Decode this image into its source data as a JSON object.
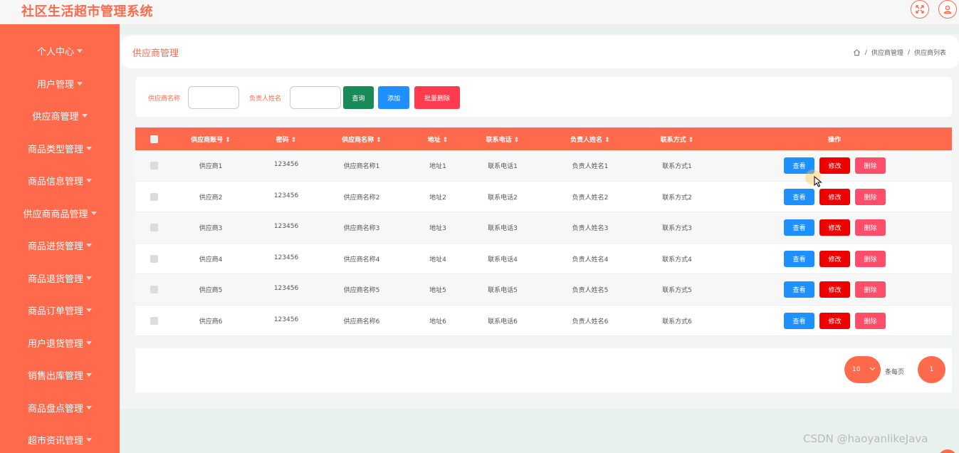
{
  "app": {
    "title": "社区生活超市管理系统"
  },
  "topbar": {
    "icons": [
      "fullscreen-icon",
      "user-icon"
    ]
  },
  "colors": {
    "accent": "#ff6a4d",
    "view": "#1e90ff",
    "edit": "#ee0000",
    "delete": "#ff4d6a",
    "query": "#1a8a5a"
  },
  "sidebar": {
    "items": [
      {
        "label": "个人中心"
      },
      {
        "label": "用户管理"
      },
      {
        "label": "供应商管理"
      },
      {
        "label": "商品类型管理"
      },
      {
        "label": "商品信息管理"
      },
      {
        "label": "供应商商品管理"
      },
      {
        "label": "商品进货管理"
      },
      {
        "label": "商品退货管理"
      },
      {
        "label": "商品订单管理"
      },
      {
        "label": "用户退货管理"
      },
      {
        "label": "销售出库管理"
      },
      {
        "label": "商品盘点管理"
      },
      {
        "label": "超市资讯管理"
      }
    ]
  },
  "header": {
    "page_title": "供应商管理",
    "breadcrumb": [
      "供应商管理",
      "供应商列表"
    ],
    "sep": "/"
  },
  "search": {
    "supplier_name_label": "供应商名称",
    "owner_name_label": "负责人姓名",
    "query_label": "查询",
    "add_label": "添加",
    "batch_delete_label": "批量删除"
  },
  "table": {
    "headers": [
      "供应商账号",
      "密码",
      "供应商名称",
      "地址",
      "联系电话",
      "负责人姓名",
      "联系方式"
    ],
    "action_header": "操作",
    "actions": {
      "view": "查看",
      "edit": "修改",
      "delete": "删除"
    },
    "rows": [
      [
        "供应商1",
        "123456",
        "供应商名称1",
        "地址1",
        "联系电话1",
        "负责人姓名1",
        "联系方式1"
      ],
      [
        "供应商2",
        "123456",
        "供应商名称2",
        "地址2",
        "联系电话2",
        "负责人姓名2",
        "联系方式2"
      ],
      [
        "供应商3",
        "123456",
        "供应商名称3",
        "地址3",
        "联系电话3",
        "负责人姓名3",
        "联系方式3"
      ],
      [
        "供应商4",
        "123456",
        "供应商名称4",
        "地址4",
        "联系电话4",
        "负责人姓名4",
        "联系方式4"
      ],
      [
        "供应商5",
        "123456",
        "供应商名称5",
        "地址5",
        "联系电话5",
        "负责人姓名5",
        "联系方式5"
      ],
      [
        "供应商6",
        "123456",
        "供应商名称6",
        "地址6",
        "联系电话6",
        "负责人姓名6",
        "联系方式6"
      ]
    ]
  },
  "pagination": {
    "page_size": "10",
    "per_page_label": "条每页",
    "current_page": "1"
  },
  "watermark": "CSDN @haoyanlikeJava"
}
